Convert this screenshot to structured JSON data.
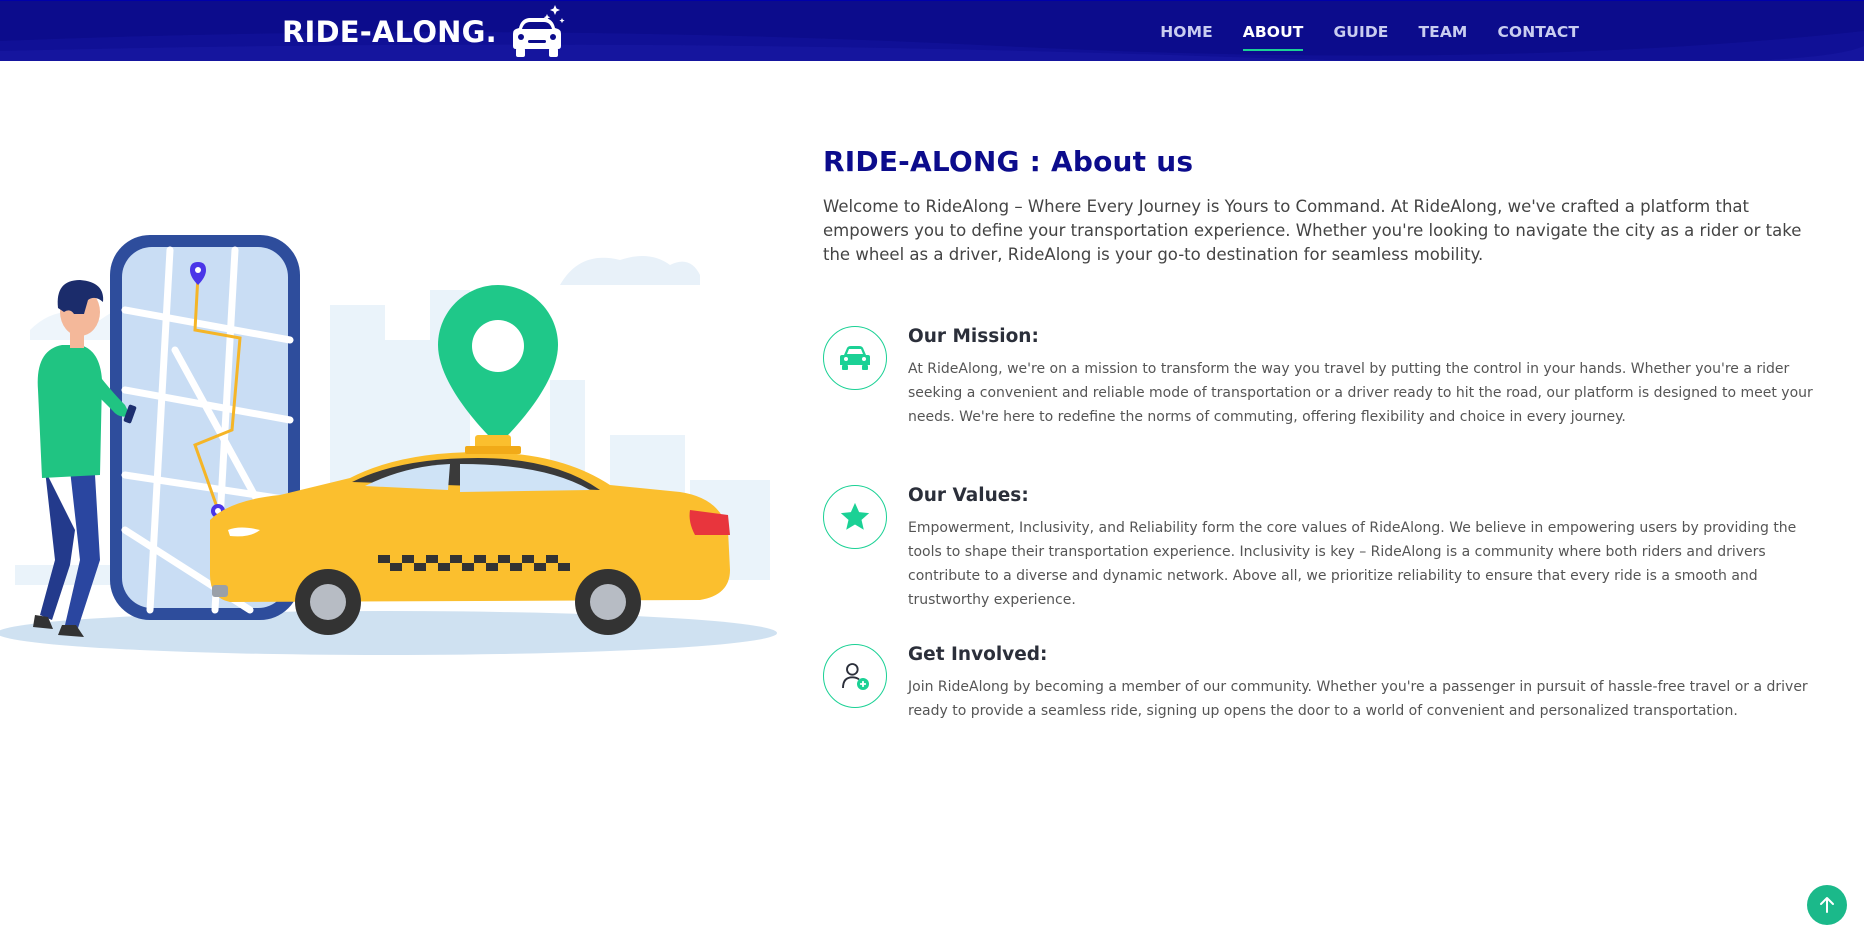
{
  "brand": {
    "name": "RIDE-ALONG."
  },
  "nav": {
    "items": [
      {
        "label": "HOME",
        "active": false
      },
      {
        "label": "ABOUT",
        "active": true
      },
      {
        "label": "GUIDE",
        "active": false
      },
      {
        "label": "TEAM",
        "active": false
      },
      {
        "label": "CONTACT",
        "active": false
      }
    ]
  },
  "about": {
    "title": "RIDE-ALONG : About us",
    "intro": "Welcome to RideAlong – Where Every Journey is Yours to Command. At RideAlong, we've crafted a platform that empowers you to define your transportation experience. Whether you're looking to navigate the city as a rider or take the wheel as a driver, RideAlong is your go-to destination for seamless mobility.",
    "features": [
      {
        "icon": "car-icon",
        "title": "Our Mission:",
        "text": "At RideAlong, we're on a mission to transform the way you travel by putting the control in your hands. Whether you're a rider seeking a convenient and reliable mode of transportation or a driver ready to hit the road, our platform is designed to meet your needs. We're here to redefine the norms of commuting, offering flexibility and choice in every journey."
      },
      {
        "icon": "star-icon",
        "title": "Our Values:",
        "text": "Empowerment, Inclusivity, and Reliability form the core values of RideAlong. We believe in empowering users by providing the tools to shape their transportation experience. Inclusivity is key – RideAlong is a community where both riders and drivers contribute to a diverse and dynamic network. Above all, we prioritize reliability to ensure that every ride is a smooth and trustworthy experience."
      },
      {
        "icon": "user-add-icon",
        "title": "Get Involved:",
        "text": "Join RideAlong by becoming a member of our community. Whether you're a passenger in pursuit of hassle-free travel or a driver ready to provide a seamless ride, signing up opens the door to a world of convenient and personalized transportation."
      }
    ]
  },
  "back_to_top": {
    "icon": "arrow-up-icon"
  },
  "colors": {
    "header_bg": "#0c0c8c",
    "accent": "#1bd195",
    "title": "#0c0c8c",
    "taxi": "#fbbf2e"
  }
}
